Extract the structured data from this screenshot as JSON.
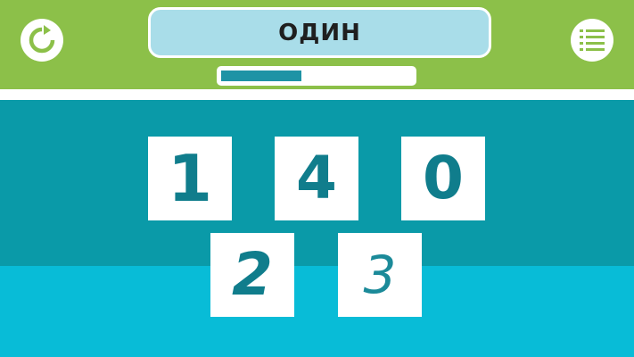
{
  "header": {
    "word": "ОДИН",
    "progress": 0.42
  },
  "buttons": {
    "restart_icon": "restart-icon",
    "menu_icon": "list-menu-icon"
  },
  "cards": [
    {
      "digit": "1"
    },
    {
      "digit": "4"
    },
    {
      "digit": "0"
    },
    {
      "digit": "2"
    },
    {
      "digit": "3"
    }
  ],
  "colors": {
    "header_green": "#8cc049",
    "upper_teal": "#0a9aa8",
    "lower_cyan": "#08bcd7",
    "word_box": "#a9dde9",
    "progress_fill": "#1e93a5",
    "digit": "#107d8c"
  }
}
